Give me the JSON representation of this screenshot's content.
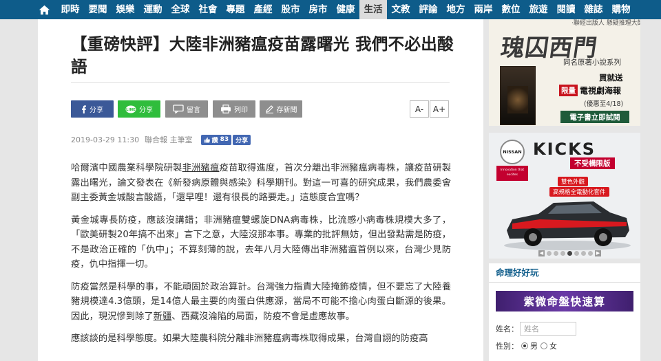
{
  "nav": {
    "items": [
      "即時",
      "要聞",
      "娛樂",
      "運動",
      "全球",
      "社會",
      "專題",
      "產經",
      "股市",
      "房市",
      "健康",
      "生活",
      "文教",
      "評論",
      "地方",
      "兩岸",
      "數位",
      "旅遊",
      "閱讀",
      "雜誌",
      "購物"
    ],
    "active": "生活"
  },
  "article": {
    "title": "【重磅快評】大陸非洲豬瘟疫苗露曙光 我們不必出酸語",
    "share": {
      "facebook": "分享",
      "line": "分享",
      "comment": "留言",
      "print": "列印",
      "save": "存新聞"
    },
    "font_minus": "A-",
    "font_plus": "A+",
    "date": "2019-03-29 11:30",
    "source": "聯合報 主筆室",
    "like_label": "讚",
    "like_count": "83",
    "share_small": "分享",
    "p1_a": "哈爾濱中國農業科學院研製",
    "p1_link": "非洲豬瘟",
    "p1_b": "疫苗取得進度，首次分離出非洲豬瘟病毒株，讓疫苗研製露出曙光，論文發表在《新發病原體與感染》科學期刊。對這一可喜的研究成果，我們農委會副主委黃金城酸言酸語，「還早哩！還有很長的路要走。」這態度合宜嗎？",
    "p2": "黃金城專長防疫，應該沒講錯；非洲豬瘟雙螺旋DNA病毒株，比流感小病毒株規模大多了，「歐美研製20年搞不出來」言下之意，大陸沒那本事。專業的批評無妨，但出發點需是防疫，不是政治正確的「仇中」；不算刻薄的說，去年八月大陸傳出非洲豬瘟首例以來，台灣少見防疫，仇中指揮一切。",
    "p3_a": "防疫當然是科學的事，不能頑固於政治算計。台灣強力指責大陸掩飾疫情，但不要忘了大陸養豬規模達4.3億頭，是14億人最主要的肉蛋白供應源，當局不可能不擔心肉蛋白斷源的後果。因此，現況慘到除了",
    "p3_link": "新疆",
    "p3_b": "、西藏沒淪陷的局面，防疫不會是虛應故事。",
    "p4": "應該談的是科學態度。如果大陸農科院分離非洲豬瘟病毒株取得成果，台灣自詡的防疫高"
  },
  "sidebar": {
    "ad1": {
      "top_text": "‧聯經出版人 懸疑推理大師 亞洲",
      "big_text": "瑰囚西門",
      "subtitle": "同名原著小說系列",
      "buy_text": "買就送",
      "limit_tag": "限量",
      "limit_text": "電視劇海報",
      "date_text": "(優惠至4/18)",
      "button": "電子書立即試閱"
    },
    "ad2": {
      "brand": "NISSAN",
      "brand_sub": "Innovation that excites",
      "model": "KICKS",
      "tag": "不受構限版",
      "feature1": "雙色外觀",
      "feature2": "高規格全電動化套件",
      "carousel_prev": "◀",
      "carousel_next": "▶"
    },
    "fortune": {
      "title": "命理好好玩",
      "banner": "紫微命盤快速算",
      "name_label": "姓名：",
      "name_placeholder": "姓名",
      "gender_label": "性別：",
      "male": "男",
      "female": "女"
    }
  },
  "colors": {
    "nav_bg": "#0e5c8a",
    "facebook": "#3b5998",
    "line": "#2fbd3c",
    "share_gray": "#8e8e8e",
    "accent_red": "#c3002f"
  }
}
